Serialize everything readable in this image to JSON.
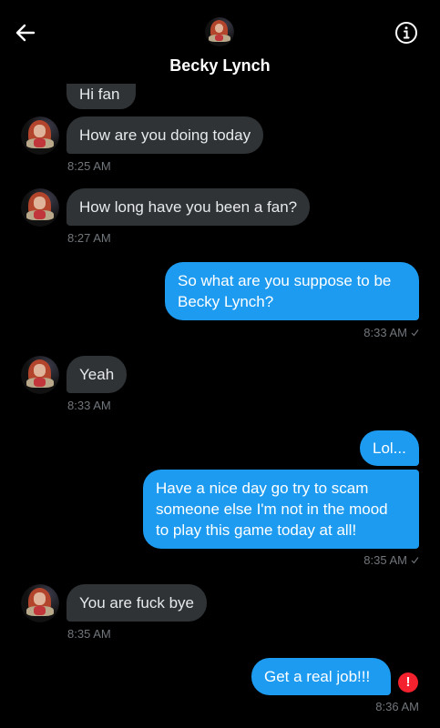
{
  "header": {
    "title": "Becky Lynch",
    "back_icon": "arrow-left-icon",
    "info_icon": "info-icon"
  },
  "colors": {
    "incoming_bubble": "#2f3336",
    "outgoing_bubble": "#1d9bf0",
    "timestamp": "#71767b",
    "error": "#f4212e"
  },
  "messages": [
    {
      "from": "them",
      "text": "Hi fan"
    },
    {
      "from": "them",
      "text": "How are you doing today",
      "time": "8:25 AM"
    },
    {
      "from": "them",
      "text": "How long have you been a fan?",
      "time": "8:27 AM"
    },
    {
      "from": "me",
      "text": "So what are you suppose to be\nBecky Lynch?",
      "time": "8:33 AM",
      "status": "sent"
    },
    {
      "from": "them",
      "text": "Yeah",
      "time": "8:33 AM"
    },
    {
      "from": "me",
      "text": "Lol..."
    },
    {
      "from": "me",
      "text": "Have a nice day go try to scam\nsomeone else I'm not in the mood\nto play this game today at all!",
      "time": "8:35 AM",
      "status": "sent"
    },
    {
      "from": "them",
      "text": "You are fuck bye",
      "time": "8:35 AM"
    },
    {
      "from": "me",
      "text": "Get a real job!!!",
      "time": "8:36 AM",
      "status": "failed",
      "status_icon": "!"
    }
  ]
}
